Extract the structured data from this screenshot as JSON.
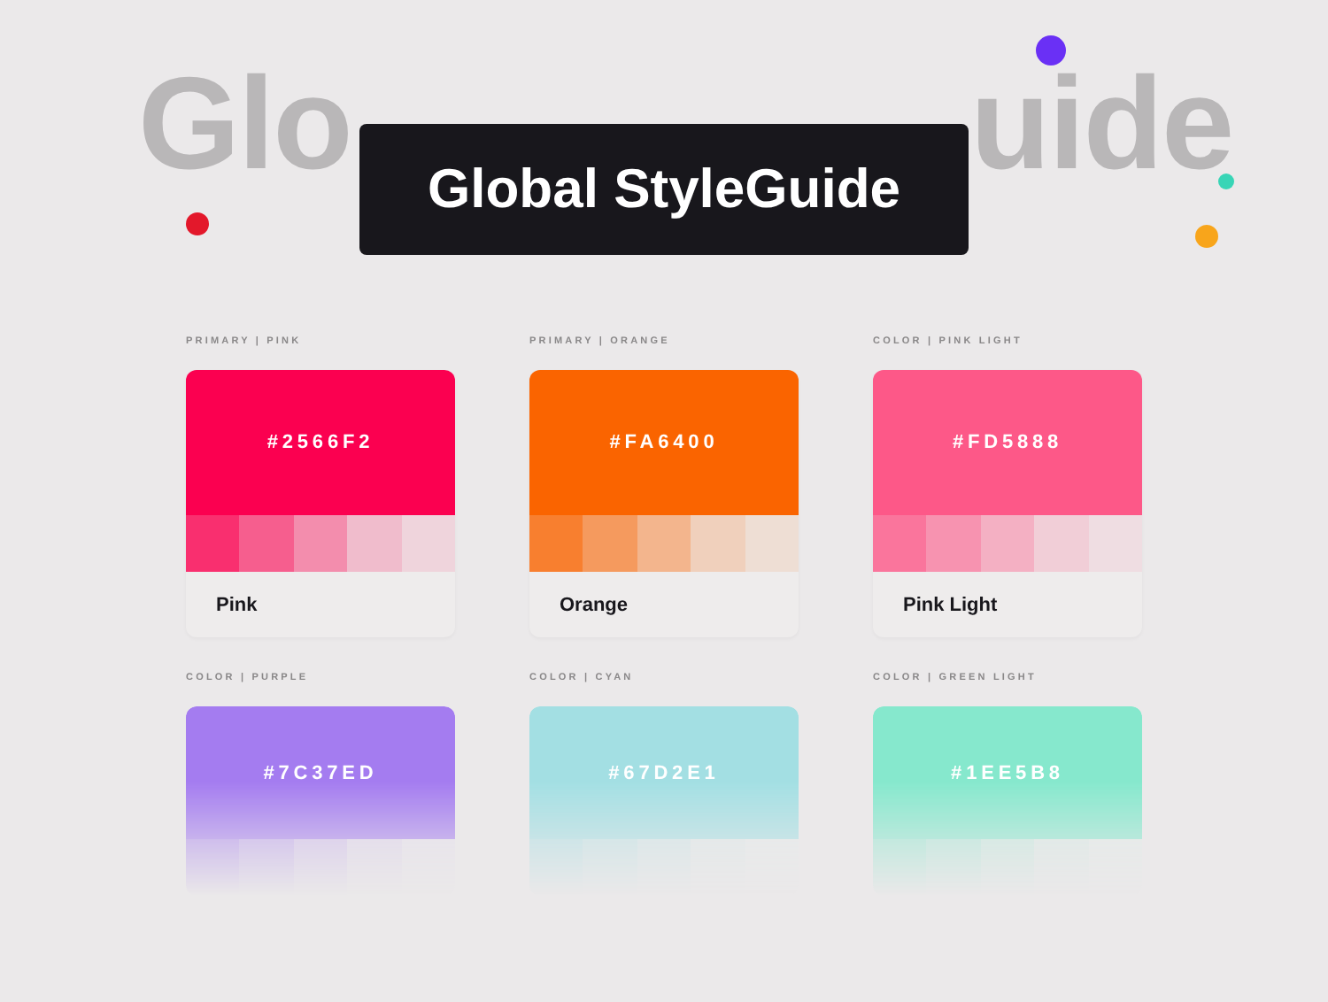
{
  "background_title_parts": [
    "Glo",
    "uide"
  ],
  "title": "Global StyleGuide",
  "colors": [
    {
      "label": "PRIMARY | PINK",
      "hex": "#2566F2",
      "color": "#fb0050",
      "name": "Pink",
      "faded": false
    },
    {
      "label": "PRIMARY | ORANGE",
      "hex": "#FA6400",
      "color": "#fa6400",
      "name": "Orange",
      "faded": false
    },
    {
      "label": "COLOR | PINK LIGHT",
      "hex": "#FD5888",
      "color": "#fd5888",
      "name": "Pink Light",
      "faded": false
    },
    {
      "label": "COLOR | PURPLE",
      "hex": "#7C37ED",
      "color": "#a47cf0",
      "faded": true
    },
    {
      "label": "COLOR | CYAN",
      "hex": "#67D2E1",
      "color": "#a3dfe3",
      "faded": true
    },
    {
      "label": "COLOR | GREEN LIGHT",
      "hex": "#1EE5B8",
      "color": "#86e8cd",
      "faded": true
    }
  ]
}
